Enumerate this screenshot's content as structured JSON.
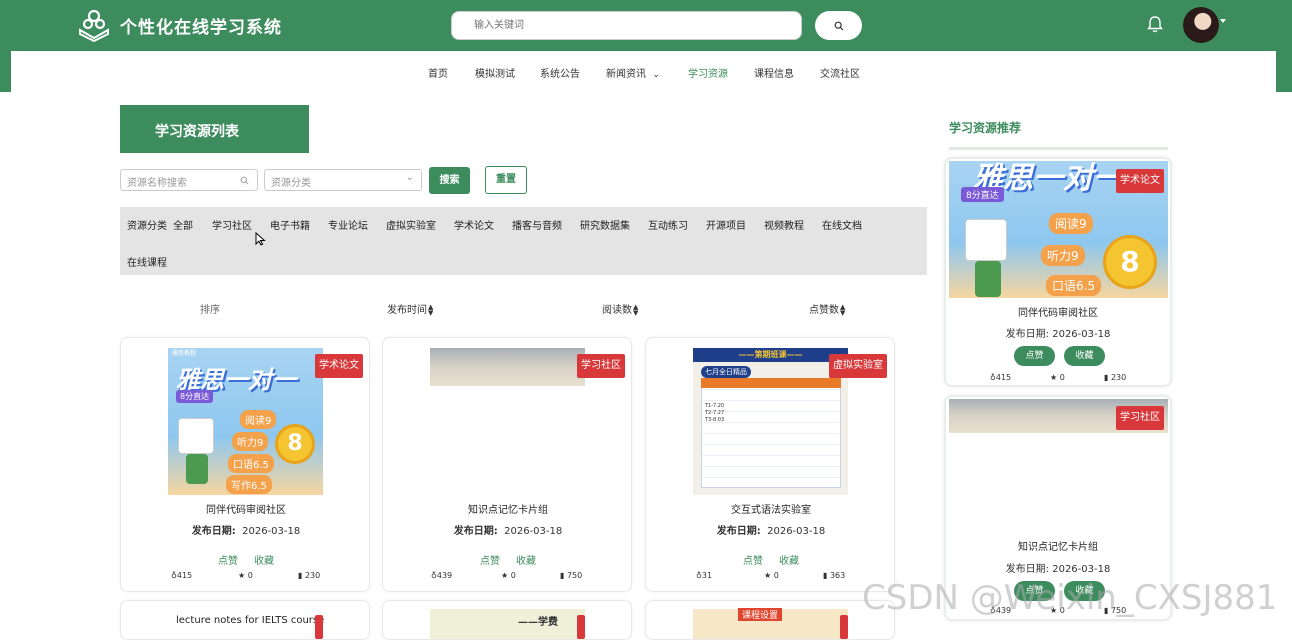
{
  "header": {
    "app_title": "个性化在线学习系统",
    "search_placeholder": "输入关键词",
    "icons": {
      "logo": "logo-icon",
      "search": "search-icon",
      "bell": "bell-icon",
      "avatar": "avatar"
    },
    "brand_color": "#3d8c5e"
  },
  "nav": {
    "items": [
      {
        "label": "首页"
      },
      {
        "label": "模拟测试"
      },
      {
        "label": "系统公告"
      },
      {
        "label": "新闻资讯"
      },
      {
        "label": "学习资源"
      },
      {
        "label": "课程信息"
      },
      {
        "label": "交流社区"
      }
    ],
    "active": "学习资源"
  },
  "main": {
    "section_title": "学习资源列表",
    "filters": {
      "name_placeholder": "资源名称搜索",
      "category_placeholder": "资源分类",
      "search_label": "搜索",
      "reset_label": "重置"
    },
    "category_label": "资源分类",
    "categories": [
      "全部",
      "学习社区",
      "电子书籍",
      "专业论坛",
      "虚拟实验室",
      "学术论文",
      "播客与音频",
      "研究数据集",
      "互动练习",
      "开源项目",
      "视频教程",
      "在线文档",
      "在线课程"
    ],
    "sort": {
      "label": "排序",
      "fields": [
        "发布时间",
        "阅读数",
        "点赞数"
      ]
    },
    "cards": [
      {
        "tag": "学术论文",
        "title": "同伴代码审阅社区",
        "date_label": "发布日期:",
        "date": "2026-03-18",
        "like_label": "点赞",
        "fav_label": "收藏",
        "likes": "415",
        "favs": "0",
        "views": "230",
        "thumb": "poster"
      },
      {
        "tag": "学习社区",
        "title": "知识点记忆卡片组",
        "date_label": "发布日期:",
        "date": "2026-03-18",
        "like_label": "点赞",
        "fav_label": "收藏",
        "likes": "439",
        "favs": "0",
        "views": "750",
        "thumb": "room"
      },
      {
        "tag": "虚拟实验室",
        "title": "交互式语法实验室",
        "date_label": "发布日期:",
        "date": "2026-03-18",
        "like_label": "点赞",
        "fav_label": "收藏",
        "likes": "31",
        "favs": "0",
        "views": "363",
        "thumb": "schedule"
      }
    ],
    "partial_row": {
      "caption": "lecture notes for IELTS course",
      "snippet": "——学费",
      "snippet2": "课程设置"
    }
  },
  "poster": {
    "headline": "雅思一对一",
    "badge": "8分直达",
    "items": [
      "阅读9",
      "听力9",
      "口语6.5",
      "写作6.5"
    ],
    "score": "8",
    "score_unit": "分",
    "corner": "雅思教程"
  },
  "schedule": {
    "title": "七月全日精品",
    "header": "——第期班课——",
    "rows": [
      "T1-7.20",
      "T2-7.27",
      "T3-8.03"
    ]
  },
  "sidebar": {
    "title": "学习资源推荐",
    "cards": [
      {
        "tag": "学术论文",
        "title": "同伴代码审阅社区",
        "date_label": "发布日期:",
        "date": "2026-03-18",
        "like_label": "点赞",
        "fav_label": "收藏",
        "likes": "415",
        "favs": "0",
        "views": "230",
        "thumb": "poster"
      },
      {
        "tag": "学习社区",
        "title": "知识点记忆卡片组",
        "date_label": "发布日期:",
        "date": "2026-03-18",
        "like_label": "点赞",
        "fav_label": "收藏",
        "likes": "439",
        "favs": "0",
        "views": "750",
        "thumb": "room"
      }
    ]
  },
  "watermark": "CSDN @Weixin_CXSJ881",
  "colors": {
    "tag_red": "#d9383a",
    "category_bg": "#e4e4e4"
  }
}
